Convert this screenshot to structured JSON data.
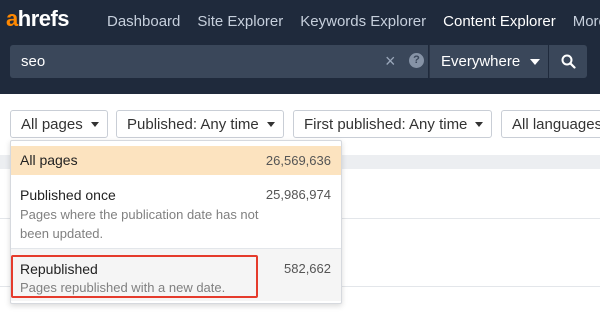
{
  "brand": {
    "logo_accent": "a",
    "logo_rest": "hrefs",
    "accent_color": "#ff8800"
  },
  "nav": {
    "items": [
      "Dashboard",
      "Site Explorer",
      "Keywords Explorer",
      "Content Explorer",
      "More"
    ],
    "active": "Content Explorer"
  },
  "search": {
    "value": "seo",
    "clear_icon": "×",
    "help_icon": "?",
    "scope": "Everywhere",
    "button_icon": "search-icon"
  },
  "filters": {
    "pages": "All pages",
    "published": "Published: Any time",
    "first_published": "First published: Any time",
    "languages": "All languages"
  },
  "dropdown": {
    "items": [
      {
        "title": "All pages",
        "count": "26,569,636",
        "description": "",
        "state": "selected"
      },
      {
        "title": "Published once",
        "count": "25,986,974",
        "description": "Pages where the publication date has not been updated.",
        "state": ""
      },
      {
        "title": "Republished",
        "count": "582,662",
        "description": "Pages republished with a new date.",
        "state": "highlighted"
      }
    ]
  },
  "colors": {
    "topbar": "#1f2a3c",
    "input": "#3a475a",
    "selected_row": "#fce3bf",
    "highlight_border": "#e53b2c"
  }
}
